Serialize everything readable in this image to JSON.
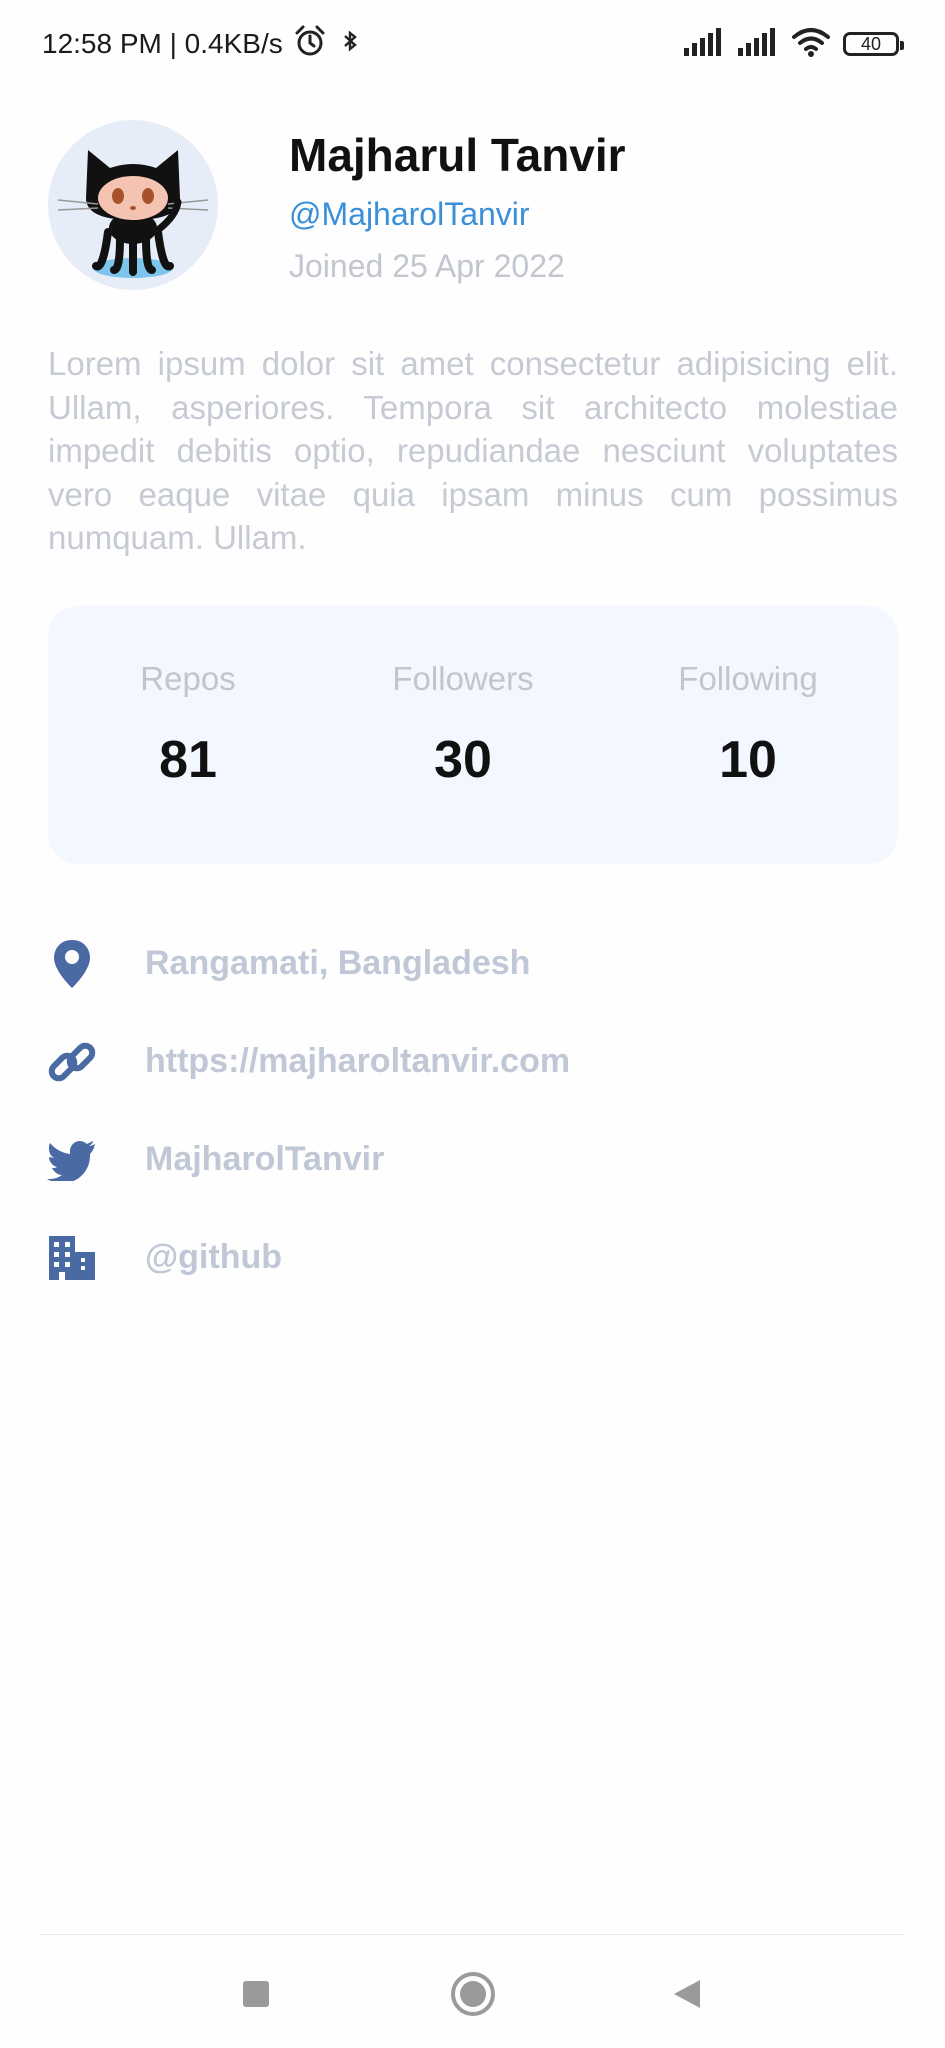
{
  "status_bar": {
    "time_net": "12:58 PM | 0.4KB/s",
    "battery": "40",
    "icons": [
      "alarm-icon",
      "bluetooth-icon",
      "signal-icon",
      "signal-icon",
      "wifi-icon",
      "battery-icon"
    ]
  },
  "profile": {
    "avatar_icon": "octocat-avatar",
    "name": "Majharul Tanvir",
    "handle": "@MajharolTanvir",
    "joined": "Joined 25 Apr 2022",
    "bio": "Lorem ipsum dolor sit amet consectetur adipisicing elit. Ullam, asperiores. Tempora sit architecto molestiae impedit debitis optio, repudiandae nesciunt voluptates vero eaque vitae quia ipsam minus cum possimus numquam. Ullam."
  },
  "stats": [
    {
      "label": "Repos",
      "value": "81"
    },
    {
      "label": "Followers",
      "value": "30"
    },
    {
      "label": "Following",
      "value": "10"
    }
  ],
  "info": {
    "location": {
      "icon": "location-pin-icon",
      "text": "Rangamati, Bangladesh"
    },
    "website": {
      "icon": "link-icon",
      "text": "https://majharoltanvir.com"
    },
    "twitter": {
      "icon": "twitter-icon",
      "text": "MajharolTanvir"
    },
    "company": {
      "icon": "building-icon",
      "text": "@github"
    }
  },
  "colors": {
    "accent": "#3b8ed8",
    "icon": "#4a6aa4",
    "muted": "#c0c7d6",
    "card": "#f3f7ff"
  },
  "nav_bar": {
    "icons": [
      "recents-square-icon",
      "home-circle-icon",
      "back-triangle-icon"
    ]
  }
}
